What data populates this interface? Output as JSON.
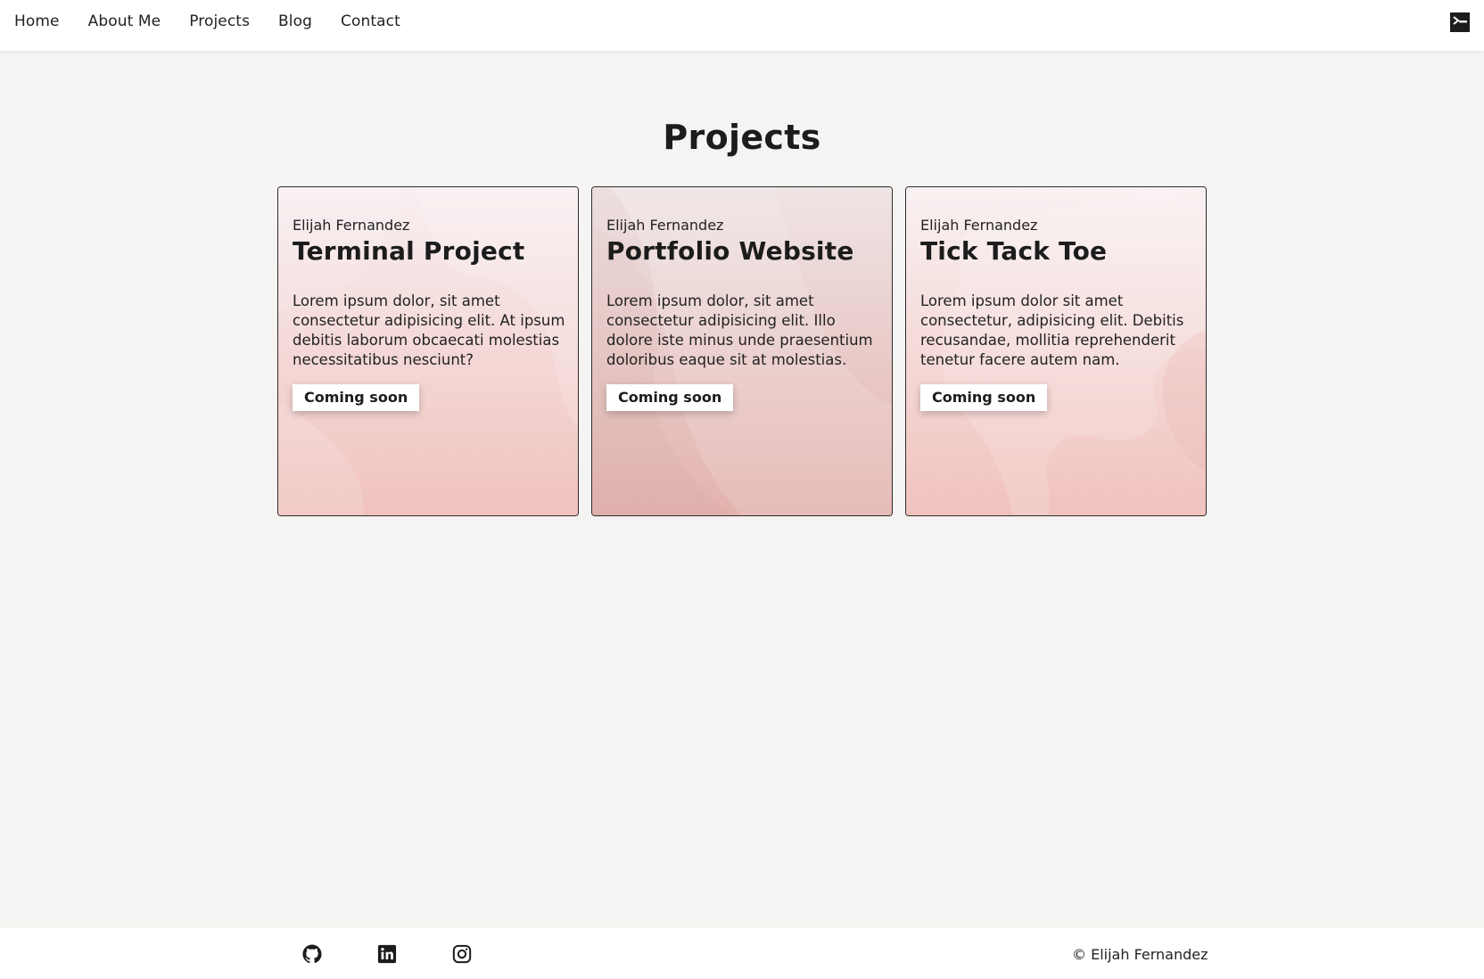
{
  "nav": {
    "links": [
      "Home",
      "About Me",
      "Projects",
      "Blog",
      "Contact"
    ],
    "terminal_icon": "terminal-icon"
  },
  "page": {
    "title": "Projects"
  },
  "projects": [
    {
      "author": "Elijah Fernandez",
      "title": "Terminal Project",
      "description": "Lorem ipsum dolor, sit amet consectetur adipisicing elit. At ipsum debitis laborum obcaecati molestias necessitatibus nesciunt?",
      "button_label": "Coming soon"
    },
    {
      "author": "Elijah Fernandez",
      "title": "Portfolio Website",
      "description": "Lorem ipsum dolor, sit amet consectetur adipisicing elit. Illo dolore iste minus unde praesentium doloribus eaque sit at molestias.",
      "button_label": "Coming soon"
    },
    {
      "author": "Elijah Fernandez",
      "title": "Tick Tack Toe",
      "description": "Lorem ipsum dolor sit amet consectetur, adipisicing elit. Debitis recusandae, mollitia reprehenderit tenetur facere autem nam.",
      "button_label": "Coming soon"
    }
  ],
  "footer": {
    "social_icons": [
      "github-icon",
      "linkedin-icon",
      "instagram-icon"
    ],
    "copyright": "© Elijah Fernandez"
  },
  "colors": {
    "background": "#f5f4f2",
    "card_gradient_top": "#f7eeef",
    "card_gradient_bottom": "#f0c4c0",
    "text": "#1f1f1f"
  }
}
